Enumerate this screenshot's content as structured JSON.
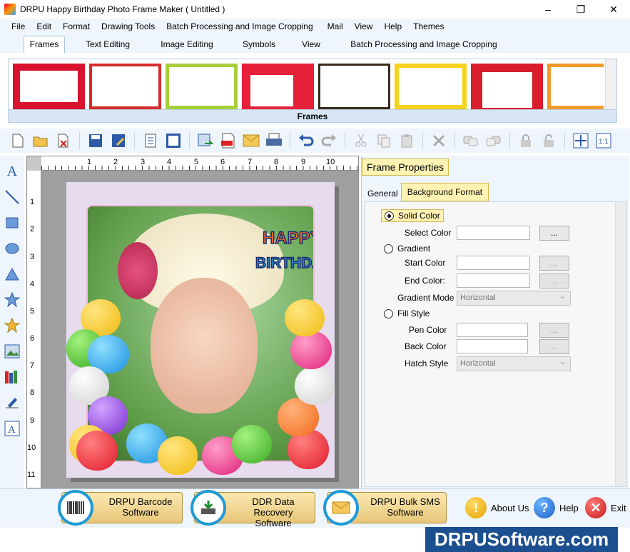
{
  "window": {
    "title": "DRPU Happy Birthday Photo Frame Maker ( Untitled )",
    "minimize": "–",
    "maximize": "❐",
    "close": "✕"
  },
  "menu": [
    "File",
    "Edit",
    "Format",
    "Drawing Tools",
    "Batch Processing and Image Cropping",
    "Mail",
    "View",
    "Help",
    "Themes"
  ],
  "ribbon_tabs": [
    "Frames",
    "Text Editing",
    "Image Editing",
    "Symbols",
    "View",
    "Batch Processing and Image Cropping"
  ],
  "frames_label": "Frames",
  "ruler_top": [
    "1",
    "2",
    "3",
    "4",
    "5",
    "6",
    "7",
    "8",
    "9",
    "10"
  ],
  "ruler_left": [
    "1",
    "2",
    "3",
    "4",
    "5",
    "6",
    "7",
    "8",
    "9",
    "10",
    "11"
  ],
  "canvas_text": {
    "happy": "HAPPY",
    "birthday": "BIRTHDAY"
  },
  "properties": {
    "title": "Frame Properties",
    "tabs": [
      "General",
      "Background Format"
    ],
    "solid_color": "Solid Color",
    "select_color": "Select Color",
    "gradient": "Gradient",
    "start_color": "Start Color",
    "end_color": "End Color:",
    "gradient_mode": "Gradient Mode",
    "gradient_mode_value": "Horizontal",
    "fill_style": "Fill Style",
    "pen_color": "Pen Color",
    "back_color": "Back Color",
    "hatch_style": "Hatch Style",
    "hatch_style_value": "Horizontal",
    "browse": "..."
  },
  "bottom": {
    "barcode": [
      "DRPU Barcode",
      "Software"
    ],
    "recovery": [
      "DDR Data Recovery",
      "Software"
    ],
    "sms": [
      "DRPU Bulk SMS",
      "Software"
    ],
    "about": "About Us",
    "help": "Help",
    "exit": "Exit"
  },
  "watermark": "DRPUSoftware.com",
  "colors": {
    "accent": "#1e9ad6",
    "tab_highlight": "#fff3b3",
    "watermark_bg": "#1b4f8f"
  }
}
